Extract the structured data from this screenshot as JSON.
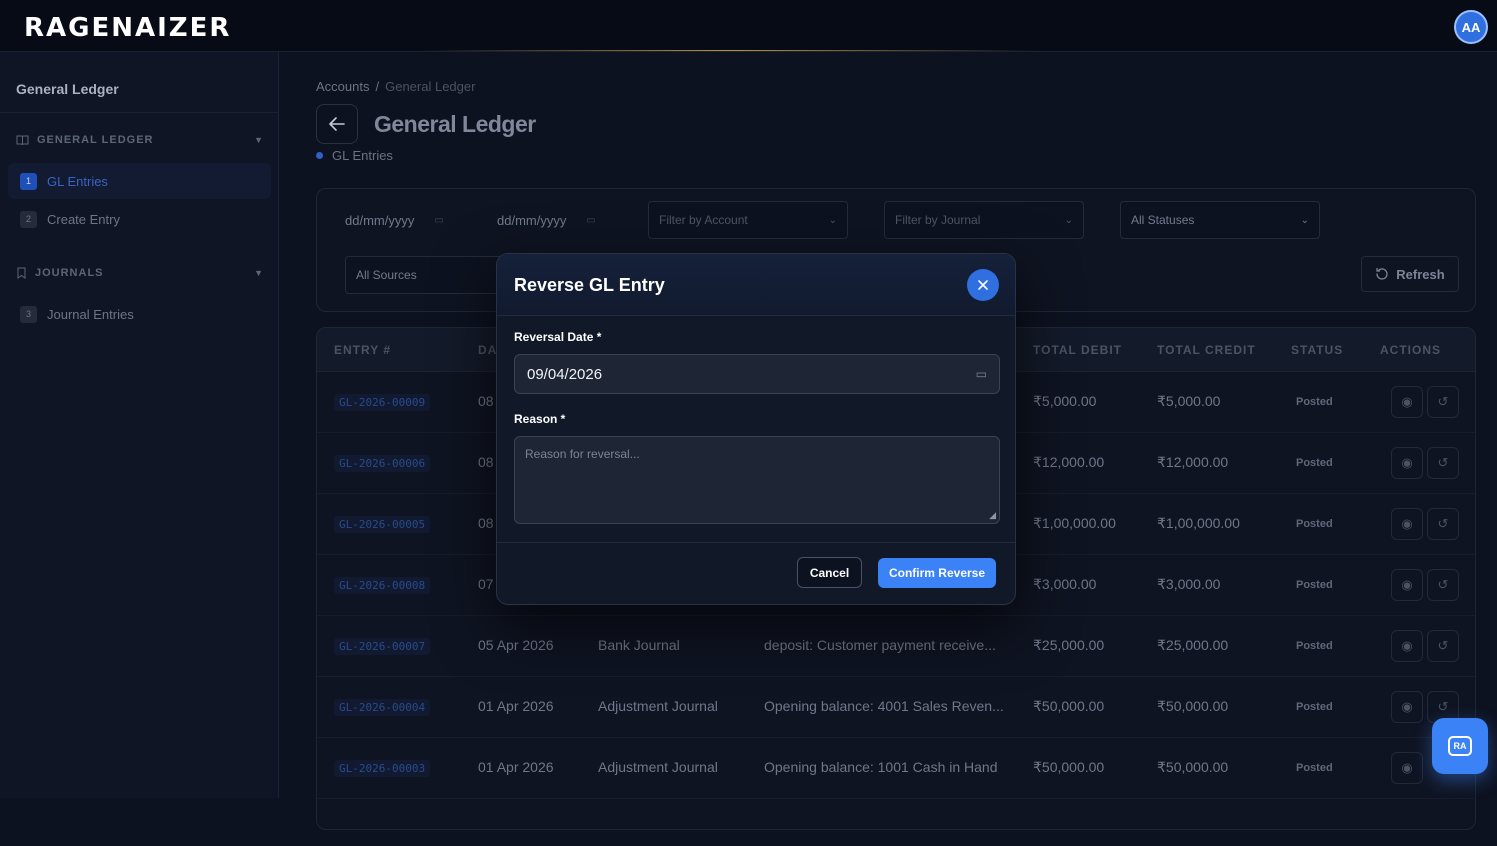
{
  "app": {
    "logo": "RAGENAIZER",
    "avatar_initials": "AA"
  },
  "sidebar": {
    "title": "General Ledger",
    "sections": [
      {
        "label": "GENERAL LEDGER",
        "items": [
          {
            "num": "1",
            "label": "GL Entries",
            "active": true
          },
          {
            "num": "2",
            "label": "Create Entry"
          }
        ]
      },
      {
        "label": "JOURNALS",
        "items": [
          {
            "num": "3",
            "label": "Journal Entries"
          }
        ]
      }
    ]
  },
  "breadcrumb": {
    "parent": "Accounts",
    "separator": "/",
    "current": "General Ledger"
  },
  "page": {
    "title": "General Ledger",
    "subtitle": "GL Entries"
  },
  "filters": {
    "date_from_placeholder": "dd/mm/yyyy",
    "date_to_placeholder": "dd/mm/yyyy",
    "account_placeholder": "Filter by Account",
    "journal_placeholder": "Filter by Journal",
    "status_value": "All Statuses",
    "source_value": "All Sources",
    "refresh_label": "Refresh"
  },
  "table": {
    "columns": [
      "ENTRY #",
      "DA",
      "TOTAL DEBIT",
      "TOTAL CREDIT",
      "STATUS",
      "ACTIONS"
    ],
    "rows": [
      {
        "id": "GL-2026-00009",
        "date": "08",
        "journal": "",
        "desc": "",
        "debit": "₹5,000.00",
        "credit": "₹5,000.00",
        "status": "Posted"
      },
      {
        "id": "GL-2026-00006",
        "date": "08",
        "journal": "",
        "desc": "",
        "debit": "₹12,000.00",
        "credit": "₹12,000.00",
        "status": "Posted"
      },
      {
        "id": "GL-2026-00005",
        "date": "08",
        "journal": "",
        "desc": "",
        "debit": "₹1,00,000.00",
        "credit": "₹1,00,000.00",
        "status": "Posted"
      },
      {
        "id": "GL-2026-00008",
        "date": "07",
        "journal": "",
        "desc": "",
        "debit": "₹3,000.00",
        "credit": "₹3,000.00",
        "status": "Posted"
      },
      {
        "id": "GL-2026-00007",
        "date": "05 Apr 2026",
        "journal": "Bank Journal",
        "desc": "deposit: Customer payment receive...",
        "debit": "₹25,000.00",
        "credit": "₹25,000.00",
        "status": "Posted"
      },
      {
        "id": "GL-2026-00004",
        "date": "01 Apr 2026",
        "journal": "Adjustment Journal",
        "desc": "Opening balance: 4001 Sales Reven...",
        "debit": "₹50,000.00",
        "credit": "₹50,000.00",
        "status": "Posted"
      },
      {
        "id": "GL-2026-00003",
        "date": "01 Apr 2026",
        "journal": "Adjustment Journal",
        "desc": "Opening balance: 1001 Cash in Hand",
        "debit": "₹50,000.00",
        "credit": "₹50,000.00",
        "status": "Posted"
      }
    ]
  },
  "modal": {
    "title": "Reverse GL Entry",
    "date_label": "Reversal Date *",
    "date_value": "09/04/2026",
    "reason_label": "Reason *",
    "reason_placeholder": "Reason for reversal...",
    "cancel_label": "Cancel",
    "confirm_label": "Confirm Reverse"
  },
  "fab": {
    "label": "RA"
  },
  "colors": {
    "accent": "#3b82f6",
    "background": "#0d1220",
    "brand_glow": "#b8953a"
  }
}
